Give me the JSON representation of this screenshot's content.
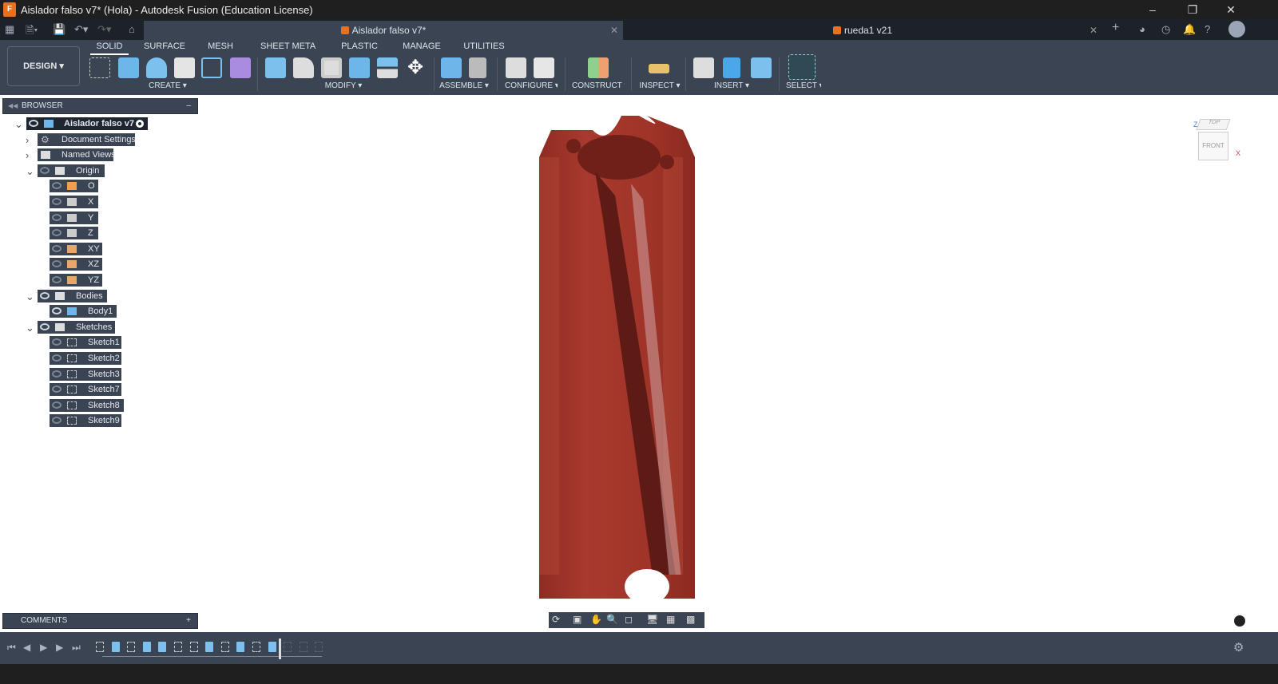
{
  "window": {
    "title": "Aislador falso v7* (Hola) - Autodesk Fusion (Education License)",
    "app_icon": "F",
    "controls": [
      "minimize",
      "restore",
      "close"
    ]
  },
  "tabs": [
    {
      "label": "Aislador falso v7*",
      "active": true
    },
    {
      "label": "rueda1 v21",
      "active": false
    }
  ],
  "toolbar": {
    "workspace": "DESIGN",
    "workspace_tabs": [
      "SOLID",
      "SURFACE",
      "MESH",
      "SHEET METAL",
      "PLASTIC",
      "MANAGE",
      "UTILITIES"
    ],
    "groups": [
      "CREATE",
      "MODIFY",
      "ASSEMBLE",
      "CONFIGURE",
      "CONSTRUCT",
      "INSPECT",
      "INSERT",
      "SELECT"
    ]
  },
  "browser": {
    "title": "BROWSER",
    "root": "Aislador falso v7",
    "items": [
      {
        "label": "Document Settings"
      },
      {
        "label": "Named Views"
      },
      {
        "label": "Origin"
      },
      {
        "label": "O"
      },
      {
        "label": "X"
      },
      {
        "label": "Y"
      },
      {
        "label": "Z"
      },
      {
        "label": "XY"
      },
      {
        "label": "XZ"
      },
      {
        "label": "YZ"
      },
      {
        "label": "Bodies"
      },
      {
        "label": "Body1"
      },
      {
        "label": "Sketches"
      },
      {
        "label": "Sketch1"
      },
      {
        "label": "Sketch2"
      },
      {
        "label": "Sketch3"
      },
      {
        "label": "Sketch7"
      },
      {
        "label": "Sketch8"
      },
      {
        "label": "Sketch9"
      }
    ]
  },
  "comments": {
    "title": "COMMENTS"
  },
  "viewcube": {
    "top": "TOP",
    "front": "FRONT",
    "axes": [
      "Z",
      "X"
    ]
  },
  "model": {
    "color": "#a8392e"
  },
  "timeline": {
    "features": [
      "sketch",
      "extrude",
      "sketch",
      "extrude",
      "extrude",
      "sketch",
      "sketch",
      "extrude",
      "sketch",
      "extrude",
      "sketch",
      "extrude",
      "sketch",
      "sketch",
      "sketch"
    ],
    "marker_after": 12
  }
}
